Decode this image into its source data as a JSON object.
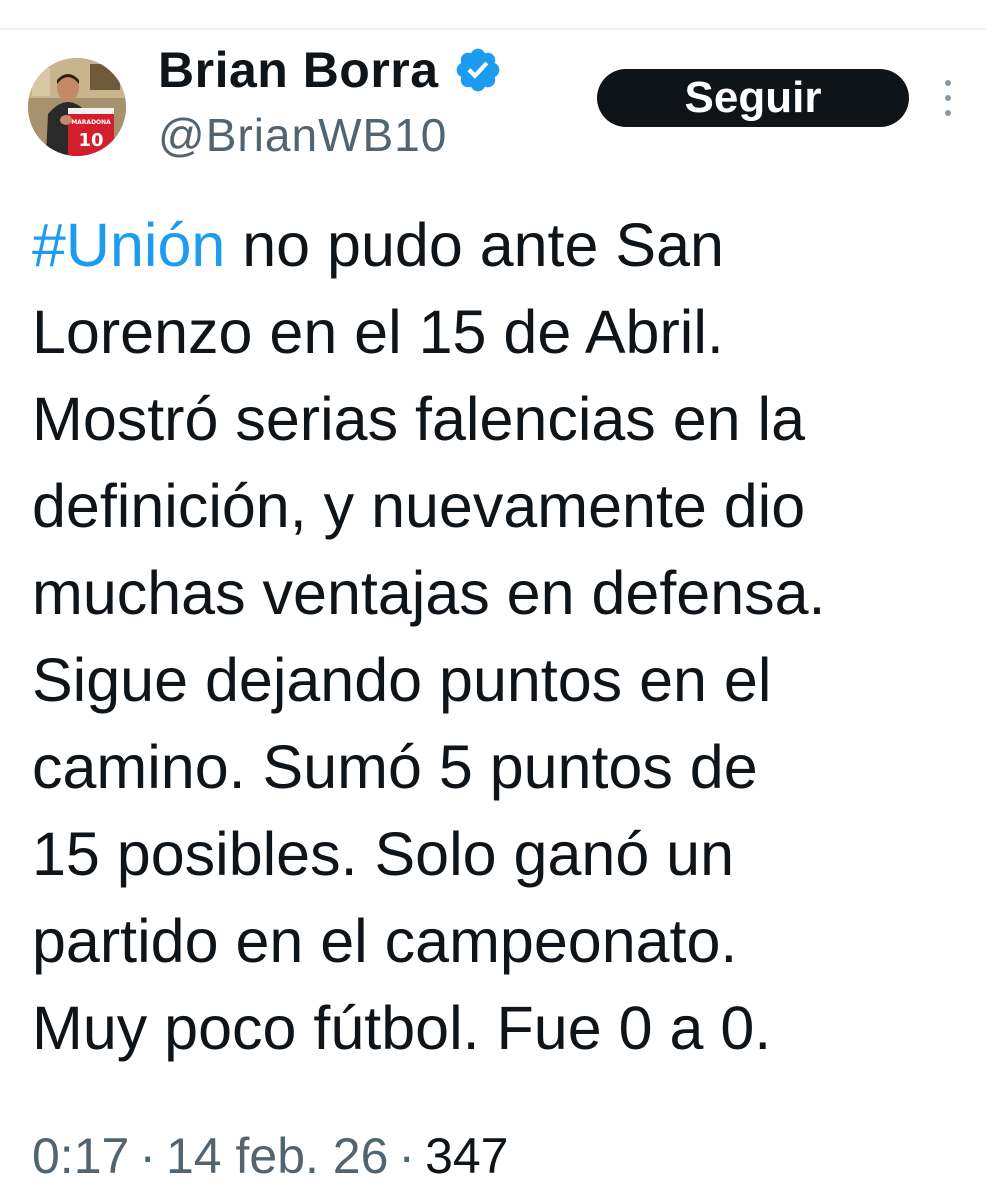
{
  "author": {
    "display_name": "Brian Borra",
    "handle": "@BrianWB10",
    "verified": true,
    "verified_color": "#1d9bf0"
  },
  "actions": {
    "follow_label": "Seguir",
    "more_icon": "more-vertical-icon"
  },
  "tweet": {
    "hashtag": "#Unión",
    "text": " no pudo ante San\nLorenzo en el 15 de Abril.\nMostró serias falencias en la\ndefinición, y nuevamente dio\nmuchas ventajas en defensa.\nSigue dejando puntos en el\ncamino. Sumó 5 puntos de\n15 posibles. Solo ganó un\npartido en el campeonato.\nMuy poco fútbol. Fue 0 a 0.",
    "hashtag_color": "#1d9bf0"
  },
  "meta": {
    "time": "0:17",
    "separator": "·",
    "date": "14 feb. 26",
    "views": "347"
  },
  "avatar": {
    "jersey_text": "MARADONA",
    "jersey_number": "10"
  }
}
